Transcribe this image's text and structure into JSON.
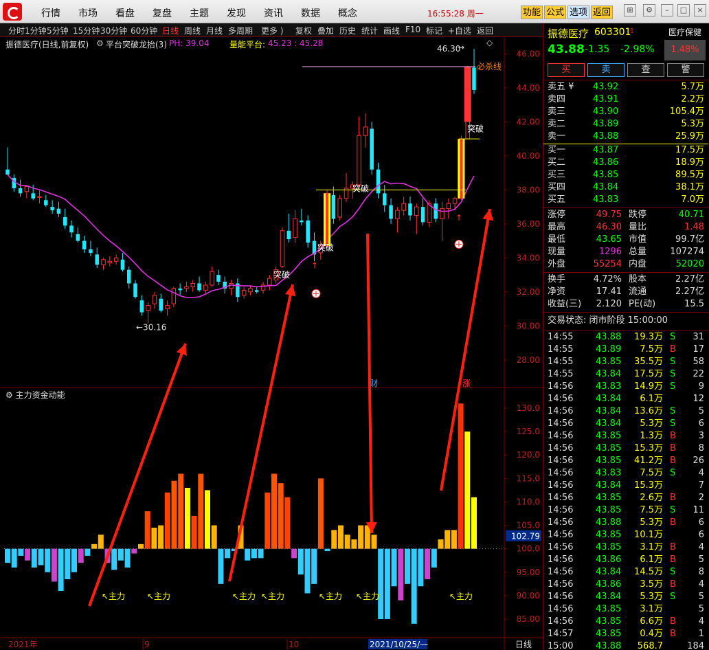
{
  "menu": [
    "行情",
    "市场",
    "看盘",
    "复盘",
    "主题",
    "发现",
    "资讯",
    "数据",
    "概念"
  ],
  "clock": "16:55:28 周一",
  "top_buttons": [
    "功能",
    "公式",
    "选项",
    "返回"
  ],
  "toolbar": [
    "分时",
    "1分钟",
    "5分钟",
    "15分钟",
    "30分钟",
    "60分钟",
    "日线",
    "周线",
    "月线",
    "多周期",
    "更多 )",
    "复权",
    "叠加",
    "历史",
    "统计",
    "画线",
    "F10",
    "标记",
    "+自选",
    "返回"
  ],
  "chart_header": {
    "title": "振德医疗(日线,前复权)",
    "indicator": "平台突破龙抬(3)",
    "ph": "PH: 39.04",
    "platform_label": "量能平台:",
    "platform_val": "45.23 : 45.28"
  },
  "chart_labels": {
    "high": "46.30",
    "low": "←30.16",
    "kill_line": "必杀线",
    "breakout": "突破",
    "cai": "财",
    "zhang": "涨",
    "sub_title": "主力资金动能",
    "sub_marker": "主力",
    "sub_cur": "102.79",
    "xaxis": [
      "2021年",
      "9",
      "10",
      "2021/10/25/一"
    ],
    "period": "日线"
  },
  "price_axis": [
    "46.00",
    "44.00",
    "42.00",
    "40.00",
    "38.00",
    "36.00",
    "34.00",
    "32.00",
    "30.00",
    "28.00"
  ],
  "sub_axis": [
    "130.0",
    "125.0",
    "120.0",
    "115.0",
    "110.0",
    "105.0",
    "100.0",
    "95.00",
    "90.00",
    "85.00"
  ],
  "colors": {
    "up": "#ff3333",
    "down": "#22e8ff",
    "ma": "#e030e0",
    "yellow": "#ffff00"
  },
  "stock": {
    "name": "振德医疗",
    "code": "603301",
    "sector": "医疗保健",
    "sector_pct": "1.48%",
    "price": "43.88",
    "change": "-1.35",
    "change_pct": "-2.98%"
  },
  "trade_buttons": [
    "买",
    "卖",
    "查",
    "警"
  ],
  "asks": [
    {
      "label": "卖五 ¥",
      "price": "43.92",
      "vol": "5.7万"
    },
    {
      "label": "卖四",
      "price": "43.91",
      "vol": "2.2万"
    },
    {
      "label": "卖三",
      "price": "43.90",
      "vol": "105.4万"
    },
    {
      "label": "卖二",
      "price": "43.89",
      "vol": "5.3万"
    },
    {
      "label": "卖一",
      "price": "43.88",
      "vol": "25.9万"
    }
  ],
  "bids": [
    {
      "label": "买一",
      "price": "43.87",
      "vol": "17.5万"
    },
    {
      "label": "买二",
      "price": "43.86",
      "vol": "18.9万"
    },
    {
      "label": "买三",
      "price": "43.85",
      "vol": "89.5万"
    },
    {
      "label": "买四",
      "price": "43.84",
      "vol": "38.1万"
    },
    {
      "label": "买五",
      "price": "43.83",
      "vol": "7.0万"
    }
  ],
  "stats": [
    {
      "l1": "涨停",
      "v1": "49.75",
      "l2": "跌停",
      "v2": "40.71",
      "c1": "#ff3333",
      "c2": "#00ff00"
    },
    {
      "l1": "最高",
      "v1": "46.30",
      "l2": "量比",
      "v2": "1.48",
      "c1": "#ff3333",
      "c2": "#ff3333"
    },
    {
      "l1": "最低",
      "v1": "43.65",
      "l2": "市值",
      "v2": "99.7亿",
      "c1": "#00ff00",
      "c2": "#dddddd"
    },
    {
      "l1": "现量",
      "v1": "1296",
      "l2": "总量",
      "v2": "107274",
      "c1": "#e030e0",
      "c2": "#dddddd"
    },
    {
      "l1": "外盘",
      "v1": "55254",
      "l2": "内盘",
      "v2": "52020",
      "c1": "#ff3333",
      "c2": "#00ff00"
    }
  ],
  "stats2": [
    {
      "l1": "换手",
      "v1": "4.72%",
      "l2": "股本",
      "v2": "2.27亿"
    },
    {
      "l1": "净资",
      "v1": "17.41",
      "l2": "流通",
      "v2": "2.27亿"
    },
    {
      "l1": "收益(三)",
      "v1": "2.120",
      "l2": "PE(动)",
      "v2": "15.5"
    }
  ],
  "trade_status": "交易状态: 闭市阶段 15:00:00",
  "ticks": [
    {
      "t": "14:55",
      "p": "43.88",
      "v": "19.3万",
      "s": "S",
      "n": "31"
    },
    {
      "t": "14:55",
      "p": "43.89",
      "v": "7.5万",
      "s": "B",
      "n": "17"
    },
    {
      "t": "14:55",
      "p": "43.85",
      "v": "35.5万",
      "s": "S",
      "n": "58"
    },
    {
      "t": "14:55",
      "p": "43.84",
      "v": "17.5万",
      "s": "S",
      "n": "22"
    },
    {
      "t": "14:56",
      "p": "43.83",
      "v": "14.9万",
      "s": "S",
      "n": "9"
    },
    {
      "t": "14:56",
      "p": "43.84",
      "v": "6.1万",
      "s": "",
      "n": "12"
    },
    {
      "t": "14:56",
      "p": "43.84",
      "v": "13.6万",
      "s": "S",
      "n": "5"
    },
    {
      "t": "14:56",
      "p": "43.84",
      "v": "5.3万",
      "s": "S",
      "n": "6"
    },
    {
      "t": "14:56",
      "p": "43.85",
      "v": "1.3万",
      "s": "B",
      "n": "3"
    },
    {
      "t": "14:56",
      "p": "43.85",
      "v": "15.3万",
      "s": "B",
      "n": "8"
    },
    {
      "t": "14:56",
      "p": "43.85",
      "v": "41.2万",
      "s": "B",
      "n": "26"
    },
    {
      "t": "14:56",
      "p": "43.83",
      "v": "7.5万",
      "s": "S",
      "n": "4"
    },
    {
      "t": "14:56",
      "p": "43.84",
      "v": "15.3万",
      "s": "",
      "n": "7"
    },
    {
      "t": "14:56",
      "p": "43.85",
      "v": "2.6万",
      "s": "B",
      "n": "2"
    },
    {
      "t": "14:56",
      "p": "43.85",
      "v": "7.5万",
      "s": "S",
      "n": "11"
    },
    {
      "t": "14:56",
      "p": "43.88",
      "v": "5.3万",
      "s": "B",
      "n": "6"
    },
    {
      "t": "14:56",
      "p": "43.85",
      "v": "10.1万",
      "s": "",
      "n": "6"
    },
    {
      "t": "14:56",
      "p": "43.85",
      "v": "3.1万",
      "s": "B",
      "n": "4"
    },
    {
      "t": "14:56",
      "p": "43.86",
      "v": "6.1万",
      "s": "B",
      "n": "5"
    },
    {
      "t": "14:56",
      "p": "43.84",
      "v": "14.5万",
      "s": "S",
      "n": "8"
    },
    {
      "t": "14:56",
      "p": "43.86",
      "v": "3.5万",
      "s": "B",
      "n": "4"
    },
    {
      "t": "14:56",
      "p": "43.84",
      "v": "5.3万",
      "s": "S",
      "n": "5"
    },
    {
      "t": "14:56",
      "p": "43.85",
      "v": "3.1万",
      "s": "",
      "n": "5"
    },
    {
      "t": "14:56",
      "p": "43.85",
      "v": "6.6万",
      "s": "B",
      "n": "4"
    },
    {
      "t": "14:57",
      "p": "43.85",
      "v": "0.4万",
      "s": "B",
      "n": "1"
    },
    {
      "t": "15:00",
      "p": "43.88",
      "v": "568.7万",
      "s": "",
      "n": "184"
    }
  ],
  "candles": [
    [
      39.2,
      40.5,
      39.0,
      38.9
    ],
    [
      38.7,
      38.9,
      37.9,
      38.1
    ],
    [
      38.1,
      38.6,
      37.6,
      37.8
    ],
    [
      37.9,
      38.3,
      37.5,
      38.2
    ],
    [
      37.8,
      38.3,
      37.4,
      37.5
    ],
    [
      37.6,
      38.0,
      37.2,
      37.6
    ],
    [
      37.4,
      37.7,
      37.0,
      37.1
    ],
    [
      37.0,
      37.4,
      36.6,
      36.8
    ],
    [
      36.9,
      37.3,
      36.4,
      36.6
    ],
    [
      36.4,
      36.9,
      35.7,
      35.9
    ],
    [
      35.9,
      36.2,
      35.2,
      35.5
    ],
    [
      35.4,
      35.8,
      34.9,
      35.0
    ],
    [
      35.0,
      35.3,
      34.3,
      34.5
    ],
    [
      34.5,
      35.0,
      34.1,
      34.3
    ],
    [
      34.2,
      34.6,
      33.4,
      33.6
    ],
    [
      33.6,
      34.0,
      33.3,
      33.9
    ],
    [
      33.7,
      34.1,
      33.5,
      33.8
    ],
    [
      33.8,
      34.2,
      33.6,
      34.0
    ],
    [
      33.9,
      34.3,
      33.2,
      33.3
    ],
    [
      33.3,
      33.5,
      32.2,
      32.5
    ],
    [
      32.5,
      32.7,
      31.6,
      31.7
    ],
    [
      31.5,
      31.8,
      30.6,
      30.8
    ],
    [
      30.9,
      31.4,
      30.16,
      31.2
    ],
    [
      31.3,
      32.0,
      31.0,
      31.8
    ],
    [
      31.6,
      31.9,
      30.8,
      30.9
    ],
    [
      31.0,
      31.5,
      30.6,
      31.2
    ],
    [
      31.3,
      32.3,
      31.1,
      32.2
    ],
    [
      32.2,
      32.5,
      31.8,
      32.1
    ],
    [
      32.2,
      32.6,
      32.0,
      32.3
    ],
    [
      32.3,
      32.7,
      32.0,
      32.5
    ],
    [
      32.5,
      32.9,
      32.0,
      32.1
    ],
    [
      32.1,
      32.6,
      31.9,
      32.4
    ],
    [
      32.4,
      33.5,
      32.3,
      33.2
    ],
    [
      33.0,
      33.3,
      32.4,
      32.6
    ],
    [
      32.6,
      32.9,
      31.9,
      32.2
    ],
    [
      32.2,
      32.7,
      31.8,
      32.5
    ],
    [
      32.5,
      32.8,
      31.4,
      31.7
    ],
    [
      31.8,
      32.3,
      31.6,
      32.1
    ],
    [
      32.0,
      32.4,
      31.8,
      32.2
    ],
    [
      32.1,
      32.3,
      31.9,
      32.0
    ],
    [
      32.1,
      32.6,
      31.9,
      32.4
    ],
    [
      32.4,
      33.0,
      32.1,
      32.8
    ],
    [
      32.7,
      33.5,
      32.5,
      33.3
    ],
    [
      33.5,
      35.8,
      33.4,
      35.6
    ],
    [
      35.6,
      36.6,
      34.9,
      35.1
    ],
    [
      35.2,
      36.8,
      34.9,
      36.3
    ],
    [
      36.2,
      36.9,
      35.9,
      36.1
    ],
    [
      36.2,
      36.5,
      34.6,
      34.9
    ],
    [
      35.0,
      35.5,
      33.8,
      34.2
    ],
    [
      34.3,
      35.0,
      33.9,
      34.7
    ],
    [
      34.7,
      38.0,
      34.6,
      37.8
    ],
    [
      37.7,
      38.2,
      36.0,
      36.3
    ],
    [
      36.4,
      37.7,
      36.2,
      37.5
    ],
    [
      37.5,
      39.0,
      37.3,
      38.1
    ],
    [
      38.1,
      38.5,
      37.5,
      38.3
    ],
    [
      38.3,
      42.3,
      38.1,
      41.2
    ],
    [
      41.2,
      42.5,
      40.5,
      41.7
    ],
    [
      41.6,
      42.0,
      38.9,
      39.2
    ],
    [
      39.2,
      39.6,
      37.5,
      37.8
    ],
    [
      37.8,
      38.3,
      36.7,
      37.1
    ],
    [
      37.1,
      37.5,
      36.0,
      36.3
    ],
    [
      36.3,
      37.0,
      35.5,
      36.8
    ],
    [
      36.8,
      37.6,
      36.5,
      37.2
    ],
    [
      37.2,
      37.6,
      36.2,
      36.5
    ],
    [
      36.5,
      37.2,
      35.4,
      37.0
    ],
    [
      37.0,
      37.5,
      35.9,
      36.1
    ],
    [
      36.1,
      37.4,
      35.8,
      37.2
    ],
    [
      37.2,
      37.5,
      36.1,
      36.3
    ],
    [
      36.3,
      37.3,
      35.0,
      36.9
    ],
    [
      36.9,
      37.5,
      36.3,
      37.2
    ],
    [
      37.2,
      37.6,
      36.8,
      37.5
    ],
    [
      37.5,
      41.2,
      37.4,
      41.0
    ],
    [
      41.0,
      45.3,
      41.0,
      45.23
    ],
    [
      45.2,
      46.3,
      43.65,
      43.88
    ]
  ],
  "sub_bars": [
    97,
    96,
    98.5,
    97.5,
    96,
    96.5,
    95,
    93,
    91,
    93.5,
    95,
    97,
    98.5,
    101,
    103,
    97,
    95.5,
    97.5,
    96,
    99,
    101,
    108,
    104.5,
    105,
    112,
    114.5,
    116,
    113,
    107,
    116,
    112.5,
    105,
    92.5,
    98,
    99.5,
    105,
    97.5,
    98,
    98,
    112,
    116,
    114,
    111,
    98,
    94.5,
    90.5,
    92.5,
    115,
    99.5,
    104,
    105,
    103,
    102,
    105,
    105,
    103,
    85,
    85,
    92,
    89,
    92.5,
    84,
    92,
    93.5,
    96,
    102,
    104,
    104,
    131,
    125,
    111
  ]
}
